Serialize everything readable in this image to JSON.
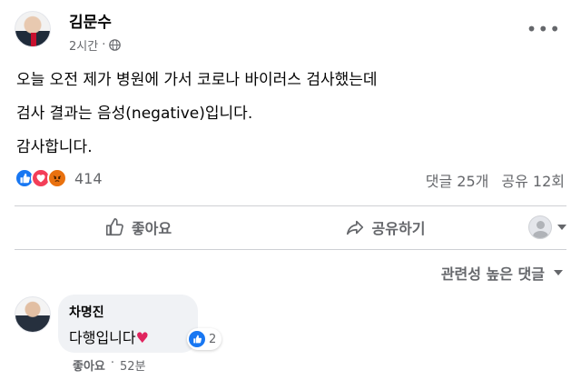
{
  "post": {
    "author": "김문수",
    "time": "2시간",
    "meta_separator": "·",
    "body_lines": [
      "오늘 오전 제가 병원에 가서 코로나 바이러스 검사했는데",
      "검사 결과는 음성(negative)입니다.",
      "감사합니다."
    ],
    "reactions": {
      "icons": [
        "like",
        "love",
        "angry"
      ],
      "count": "414"
    },
    "comments_count": "댓글 25개",
    "shares_count": "공유 12회",
    "actions": {
      "like": "좋아요",
      "share": "공유하기"
    }
  },
  "comments_section": {
    "sort_label": "관련성 높은 댓글",
    "comments": [
      {
        "author": "차명진",
        "text": "다행입니다",
        "emoji": "♥",
        "reaction_count": "2",
        "like_label": "좋아요",
        "separator": "·",
        "time": "52분"
      }
    ]
  },
  "colors": {
    "brand_blue": "#1877f2",
    "secondary_text": "#65676b",
    "divider": "#ced0d4",
    "comment_bubble": "#f0f2f5"
  }
}
